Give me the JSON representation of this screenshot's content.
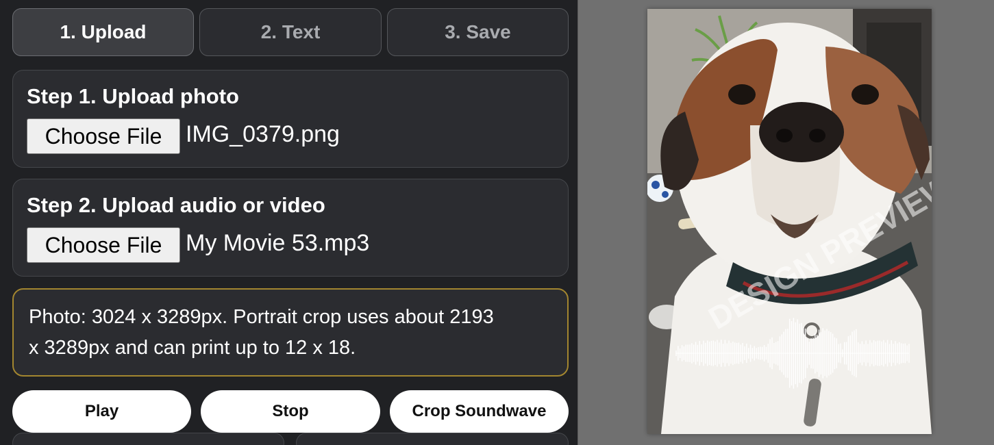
{
  "tabs": [
    {
      "label": "1. Upload",
      "active": true
    },
    {
      "label": "2. Text",
      "active": false
    },
    {
      "label": "3. Save",
      "active": false
    }
  ],
  "steps": [
    {
      "title": "Step 1. Upload photo",
      "button_label": "Choose File",
      "file_name": "IMG_0379.png"
    },
    {
      "title": "Step 2. Upload audio or video",
      "button_label": "Choose File",
      "file_name": "My Movie 53.mp3"
    }
  ],
  "info": {
    "line1": "Photo: 3024 x 3289px. Portrait crop uses about 2193",
    "line2": "x 3289px and can print up to 12 x 18."
  },
  "buttons": {
    "play": "Play",
    "stop": "Stop",
    "crop": "Crop Soundwave"
  },
  "preview": {
    "watermark": "DESIGN PREVIEW",
    "soundwave_color": "#ffffff",
    "info_border_color": "#a3862f"
  }
}
